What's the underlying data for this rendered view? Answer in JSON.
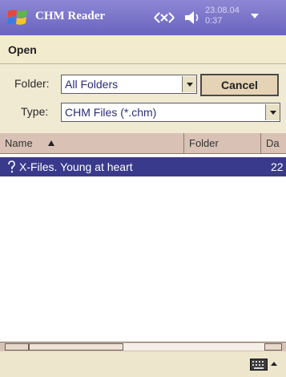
{
  "titlebar": {
    "app_title": "CHM Reader",
    "clock_date": "23.08.04",
    "clock_time": "0:37"
  },
  "menubar": {
    "open_label": "Open"
  },
  "form": {
    "folder_label": "Folder:",
    "folder_value": "All Folders",
    "type_label": "Type:",
    "type_value": "CHM Files (*.chm)",
    "cancel_label": "Cancel"
  },
  "list": {
    "columns": [
      {
        "label": "Name"
      },
      {
        "label": "Folder"
      },
      {
        "label": "Da"
      }
    ],
    "rows": [
      {
        "name": "X-Files. Young at heart",
        "date": "22",
        "selected": true
      }
    ]
  },
  "icons": {
    "start": "windows-start-icon",
    "connectivity": "connectivity-icon",
    "volume": "speaker-icon",
    "keyboard": "keyboard-icon"
  },
  "colors": {
    "titlebar": "#7670c8",
    "selection": "#3a3a8c",
    "menubar": "#f3ebcd"
  }
}
